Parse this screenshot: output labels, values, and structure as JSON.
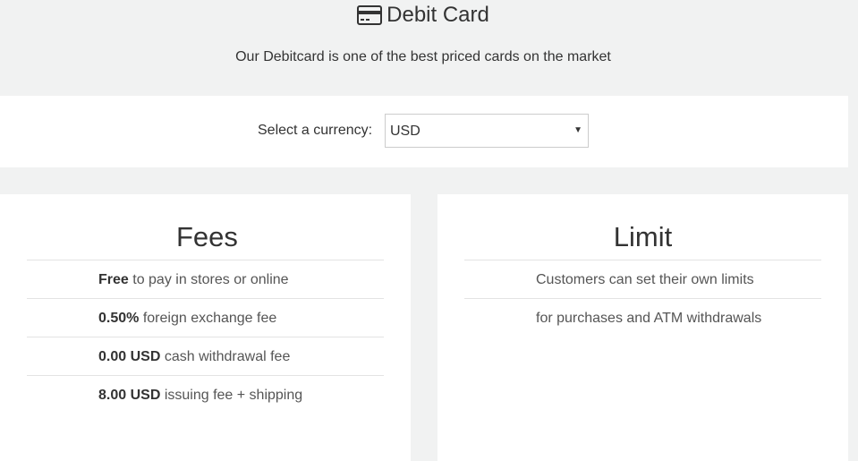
{
  "header": {
    "title": "Debit Card",
    "icon": "credit-card-icon",
    "subtitle": "Our Debitcard is one of the best priced cards on the market"
  },
  "currency": {
    "label": "Select a currency:",
    "selected": "USD"
  },
  "fees": {
    "title": "Fees",
    "items": [
      {
        "bold": "Free",
        "text": " to pay in stores or online"
      },
      {
        "bold": "0.50%",
        "text": " foreign exchange fee"
      },
      {
        "bold": "0.00 USD",
        "text": " cash withdrawal fee"
      },
      {
        "bold": "8.00 USD",
        "text": " issuing fee + shipping"
      }
    ]
  },
  "limit": {
    "title": "Limit",
    "items": [
      "Customers can set their own limits",
      "for purchases and ATM withdrawals"
    ]
  },
  "colors": {
    "background": "#f1f2f2",
    "panel": "#ffffff",
    "text": "#333333",
    "divider": "#e3e3e3"
  }
}
